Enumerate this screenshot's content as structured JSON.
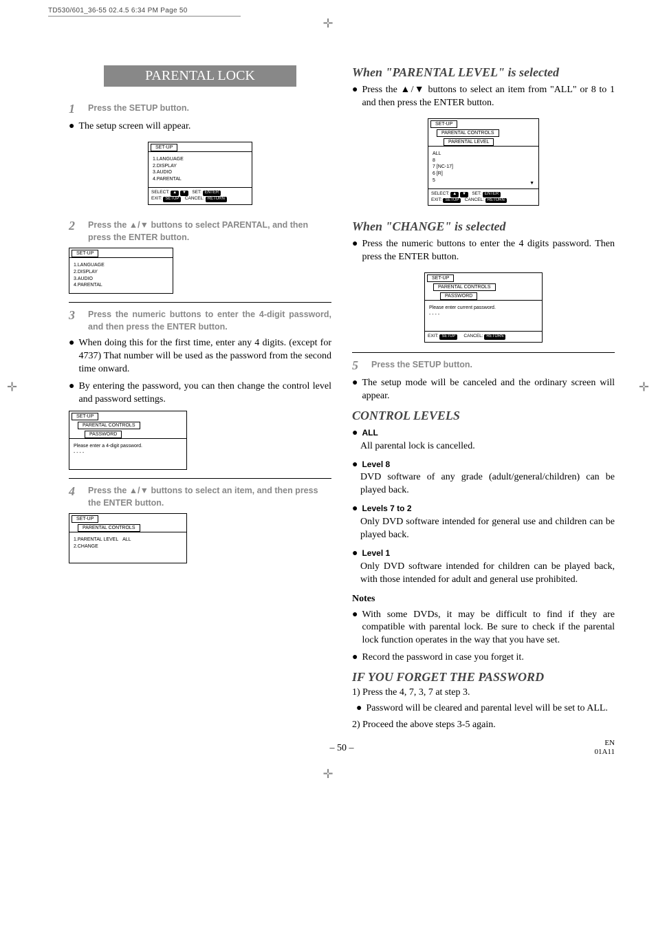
{
  "header": "TD530/601_36-55  02.4.5 6:34 PM  Page 50",
  "title": "PARENTAL LOCK",
  "steps": {
    "s1": "Press the SETUP button.",
    "s1n": "1",
    "s1_after": "The setup screen will appear.",
    "s2": "Press the ▲/▼ buttons to select PARENTAL, and then press the ENTER button.",
    "s2n": "2",
    "s3": "Press the numeric buttons to enter the 4-digit password, and then press the ENTER button.",
    "s3n": "3",
    "s3_b1": "When doing this for the first time, enter any 4 digits. (except for 4737) That number will be used as the password from the second time onward.",
    "s3_b2": "By entering the password, you can then change the control level and password settings.",
    "s4": "Press the ▲/▼ buttons to select an item, and then press the ENTER button.",
    "s4n": "4",
    "s5": "Press the SETUP button.",
    "s5n": "5",
    "s5_after": "The setup mode will be canceled and the ordinary screen will appear."
  },
  "right": {
    "h1": "When \"PARENTAL LEVEL\" is selected",
    "h1_b": "Press the ▲/▼ buttons to select an item from \"ALL\" or 8 to 1 and then press the ENTER button.",
    "h2": "When \"CHANGE\" is selected",
    "h2_b": "Press the numeric buttons to enter the 4 digits password. Then press the ENTER button."
  },
  "control": {
    "head": "CONTROL LEVELS",
    "all_h": "ALL",
    "all_b": "All parental lock is cancelled.",
    "l8_h": "Level 8",
    "l8_b": "DVD software of any grade (adult/general/children) can be played back.",
    "l72_h": "Levels 7 to 2",
    "l72_b": "Only DVD software intended for general use and children can be played back.",
    "l1_h": "Level 1",
    "l1_b": "Only DVD software intended for children can be played back, with those intended for adult and general use prohibited."
  },
  "notes": {
    "head": "Notes",
    "n1": "With some DVDs, it may be difficult to find if they are compatible with parental lock. Be sure to check if the parental lock function operates in the way that you have set.",
    "n2": "Record the password in case you forget it."
  },
  "forget": {
    "head": "IF YOU FORGET THE PASSWORD",
    "l1": "1) Press the 4, 7, 3, 7 at step 3.",
    "b1": "Password will be cleared and parental level will be set to ALL.",
    "l2": "2) Proceed the above steps 3-5 again."
  },
  "foot": {
    "page": "– 50 –",
    "en": "EN",
    "code": "01A11"
  },
  "osd": {
    "setup": "SET-UP",
    "m_lang": "1.LANGUAGE",
    "m_disp": "2.DISPLAY",
    "m_audio": "3.AUDIO",
    "m_par": "4.PARENTAL",
    "select": "SELECT:",
    "set": "SET:",
    "exit": "EXIT:",
    "cancel": "CANCEL:",
    "enter": "ENTER",
    "setup_pill": "SETUP",
    "return_pill": "RETURN",
    "parental_controls": "PARENTAL CONTROLS",
    "password": "PASSWORD",
    "enter4": "Please enter a 4-digit password.",
    "enter_current": "Please enter current password.",
    "dashes": "- - - -",
    "parental_level": "PARENTAL LEVEL",
    "pl1": "1.PARENTAL LEVEL",
    "pl1v": "ALL",
    "pl2": "2.CHANGE",
    "lvl_all": "ALL",
    "lvl_8": "8",
    "lvl_7": "7 [NC-17]",
    "lvl_6": "6 [R]",
    "lvl_5": "5"
  }
}
